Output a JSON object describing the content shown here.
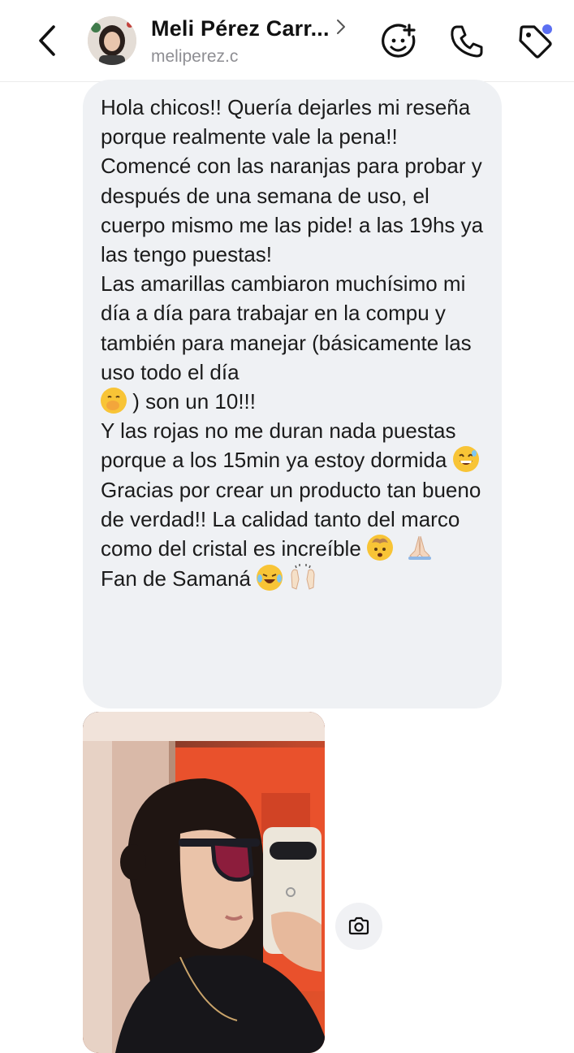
{
  "header": {
    "contact_name": "Meli Pérez Carr...",
    "username": "meliperez.c",
    "icons": [
      "back-chevron-icon",
      "chevron-right-icon",
      "add-sticker-icon",
      "phone-icon",
      "tag-icon"
    ],
    "notification_dot_color": "#5b6ff2"
  },
  "message": {
    "bubble_color": "#eff1f4",
    "paragraphs": [
      "Hola chicos!! Quería dejarles mi reseña porque realmente vale la pena!! Comencé con las naranjas para probar y después de una semana de uso, el cuerpo mismo me las pide! a las 19hs ya las tengo puestas!",
      "Las amarillas cambiaron muchísimo mi día a día para trabajar en la compu y  también para manejar (básicamente las uso todo el día",
      ") son un 10!!!",
      "Y las rojas no me duran nada puestas porque a los 15min ya estoy dormida",
      "Gracias por crear un producto tan bueno de verdad!! La calidad tanto del marco como del cristal es increíble",
      "Fan de Samaná"
    ],
    "emojis": [
      "face-with-hand-over-mouth",
      "grinning-sweat",
      "exploding-head",
      "folded-hands",
      "tears-of-joy",
      "raising-hands"
    ]
  },
  "photo_message": {
    "description_icon": "mirror-selfie-photo",
    "action_icon": "camera-icon"
  }
}
